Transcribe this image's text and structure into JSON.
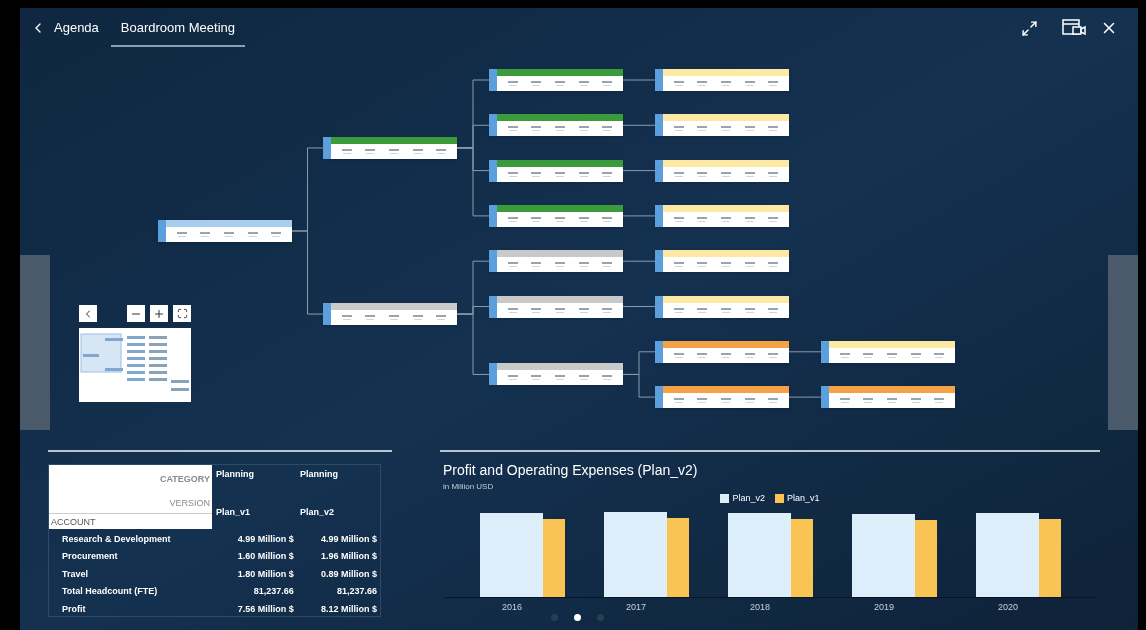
{
  "header": {
    "back_label": "Agenda",
    "tabs": [
      {
        "label": "Boardroom Meeting",
        "selected": true
      }
    ]
  },
  "tree": {
    "color": "#a9cdee",
    "children": [
      {
        "color": "#3b9b3b",
        "children": [
          {
            "color": "#3b9b3b",
            "children": [
              {
                "color": "#fde8a4"
              }
            ]
          },
          {
            "color": "#3b9b3b",
            "children": [
              {
                "color": "#fde8a4"
              }
            ]
          },
          {
            "color": "#3b9b3b",
            "children": [
              {
                "color": "#fde8a4"
              }
            ]
          },
          {
            "color": "#3b9b3b",
            "children": [
              {
                "color": "#fde8a4"
              }
            ]
          }
        ]
      },
      {
        "color": "#c9c9c9",
        "children": [
          {
            "color": "#c9c9c9",
            "children": [
              {
                "color": "#fde8a4"
              }
            ]
          },
          {
            "color": "#c9c9c9",
            "children": [
              {
                "color": "#fde8a4"
              }
            ]
          },
          {
            "color": "#c9c9c9",
            "children": [
              {
                "color": "#f5a145",
                "children": [
                  {
                    "color": "#fde8a4"
                  }
                ]
              },
              {
                "color": "#f5a145",
                "children": [
                  {
                    "color": "#f5a145"
                  }
                ]
              }
            ]
          }
        ]
      }
    ]
  },
  "table": {
    "category_label": "CATEGORY",
    "categories": [
      "Planning",
      "Planning"
    ],
    "version_label": "VERSION",
    "versions": [
      "Plan_v1",
      "Plan_v2"
    ],
    "account_label": "ACCOUNT",
    "rows": [
      {
        "account": "Research & Development",
        "values": [
          "4.99 Million $",
          "4.99 Million $"
        ]
      },
      {
        "account": "Procurement",
        "values": [
          "1.60 Million $",
          "1.96 Million $"
        ]
      },
      {
        "account": "Travel",
        "values": [
          "1.80 Million $",
          "0.89 Million $"
        ]
      },
      {
        "account": "Total Headcount (FTE)",
        "values": [
          "81,237.66",
          "81,237.66"
        ]
      },
      {
        "account": "Profit",
        "values": [
          "7.56 Million $",
          "8.12 Million $"
        ]
      }
    ]
  },
  "chart": {
    "title": "Profit and Operating Expenses (Plan_v2)",
    "subtitle": "in Million USD",
    "series": [
      {
        "name": "Plan_v2",
        "color": "#dbeefa"
      },
      {
        "name": "Plan_v1",
        "color": "#f9c454"
      }
    ],
    "categories": [
      "2016",
      "2017",
      "2018",
      "2019",
      "2020"
    ]
  },
  "pages": [
    {
      "selected": false
    },
    {
      "selected": true
    },
    {
      "selected": false
    }
  ]
}
